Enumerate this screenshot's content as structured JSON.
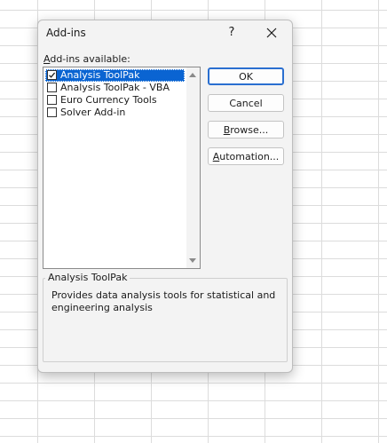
{
  "dialog": {
    "title": "Add-ins",
    "help_label": "?",
    "close_icon": "close-icon"
  },
  "addins": {
    "label_accel": "A",
    "label_rest": "dd-ins available:",
    "items": [
      {
        "label": "Analysis ToolPak",
        "checked": true,
        "selected": true
      },
      {
        "label": "Analysis ToolPak - VBA",
        "checked": false,
        "selected": false
      },
      {
        "label": "Euro Currency Tools",
        "checked": false,
        "selected": false
      },
      {
        "label": "Solver Add-in",
        "checked": false,
        "selected": false
      }
    ]
  },
  "buttons": {
    "ok": "OK",
    "cancel": "Cancel",
    "browse_accel": "B",
    "browse_rest": "rowse...",
    "automation_accel": "A",
    "automation_rest": "utomation..."
  },
  "description": {
    "title": "Analysis ToolPak",
    "text": "Provides data analysis tools for statistical and engineering analysis"
  },
  "colors": {
    "selection": "#0a64d2",
    "default_button_border": "#2a6fd0",
    "dialog_background": "#f3f3f3"
  }
}
